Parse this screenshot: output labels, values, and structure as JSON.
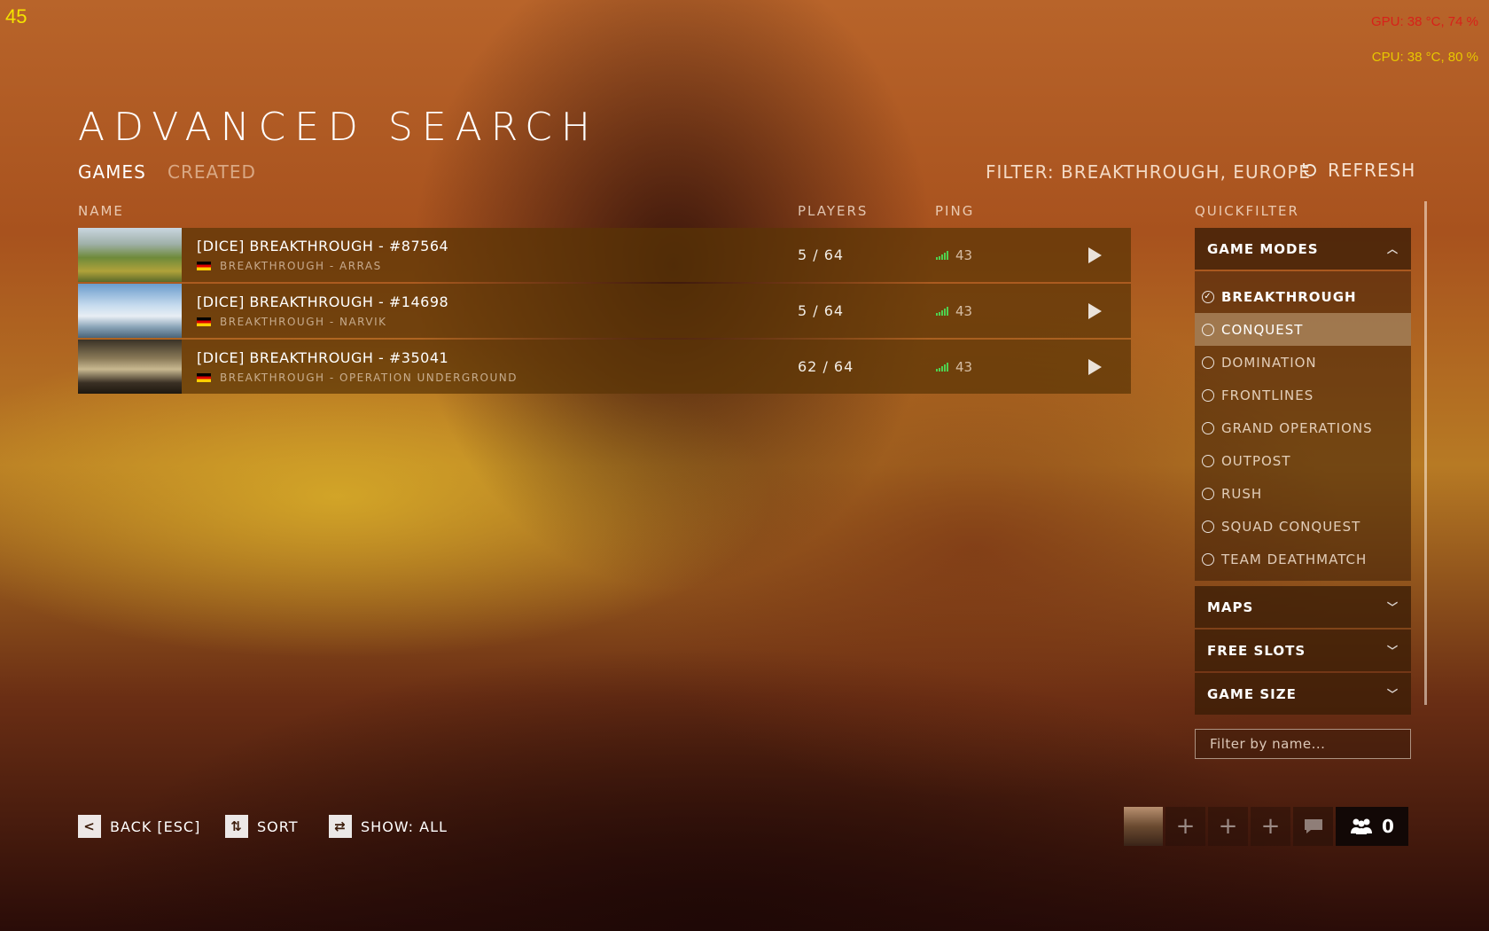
{
  "overlay": {
    "fps": "45",
    "gpu": "GPU: 38 °C, 74 %",
    "cpu": "CPU: 38 °C, 80 %"
  },
  "page": {
    "title": "ADVANCED SEARCH"
  },
  "tabs": {
    "games": "GAMES",
    "created": "CREATED"
  },
  "filter": {
    "text": "FILTER: BREAKTHROUGH, EUROPE",
    "refresh_label": "REFRESH"
  },
  "columns": {
    "name": "NAME",
    "players": "PLAYERS",
    "ping": "PING"
  },
  "servers": [
    {
      "name": "[DICE] BREAKTHROUGH - #87564",
      "subtitle": "BREAKTHROUGH - ARRAS",
      "players": "5 / 64",
      "ping": "43"
    },
    {
      "name": "[DICE] BREAKTHROUGH - #14698",
      "subtitle": "BREAKTHROUGH - NARVIK",
      "players": "5 / 64",
      "ping": "43"
    },
    {
      "name": "[DICE] BREAKTHROUGH - #35041",
      "subtitle": "BREAKTHROUGH - OPERATION UNDERGROUND",
      "players": "62 / 64",
      "ping": "43"
    }
  ],
  "quickfilter": {
    "label": "QUICKFILTER",
    "game_modes": {
      "title": "GAME MODES",
      "items": [
        "BREAKTHROUGH",
        "CONQUEST",
        "DOMINATION",
        "FRONTLINES",
        "GRAND OPERATIONS",
        "OUTPOST",
        "RUSH",
        "SQUAD CONQUEST",
        "TEAM DEATHMATCH"
      ],
      "selected": "BREAKTHROUGH"
    },
    "maps": "MAPS",
    "free_slots": "FREE SLOTS",
    "game_size": "GAME SIZE",
    "name_filter_placeholder": "Filter by name..."
  },
  "footer": {
    "back_key": "<",
    "back_label": "BACK [ESC]",
    "sort_key": "⇅",
    "sort_label": "SORT",
    "show_key": "⇄",
    "show_label": "SHOW: ALL",
    "party_count": "0"
  }
}
